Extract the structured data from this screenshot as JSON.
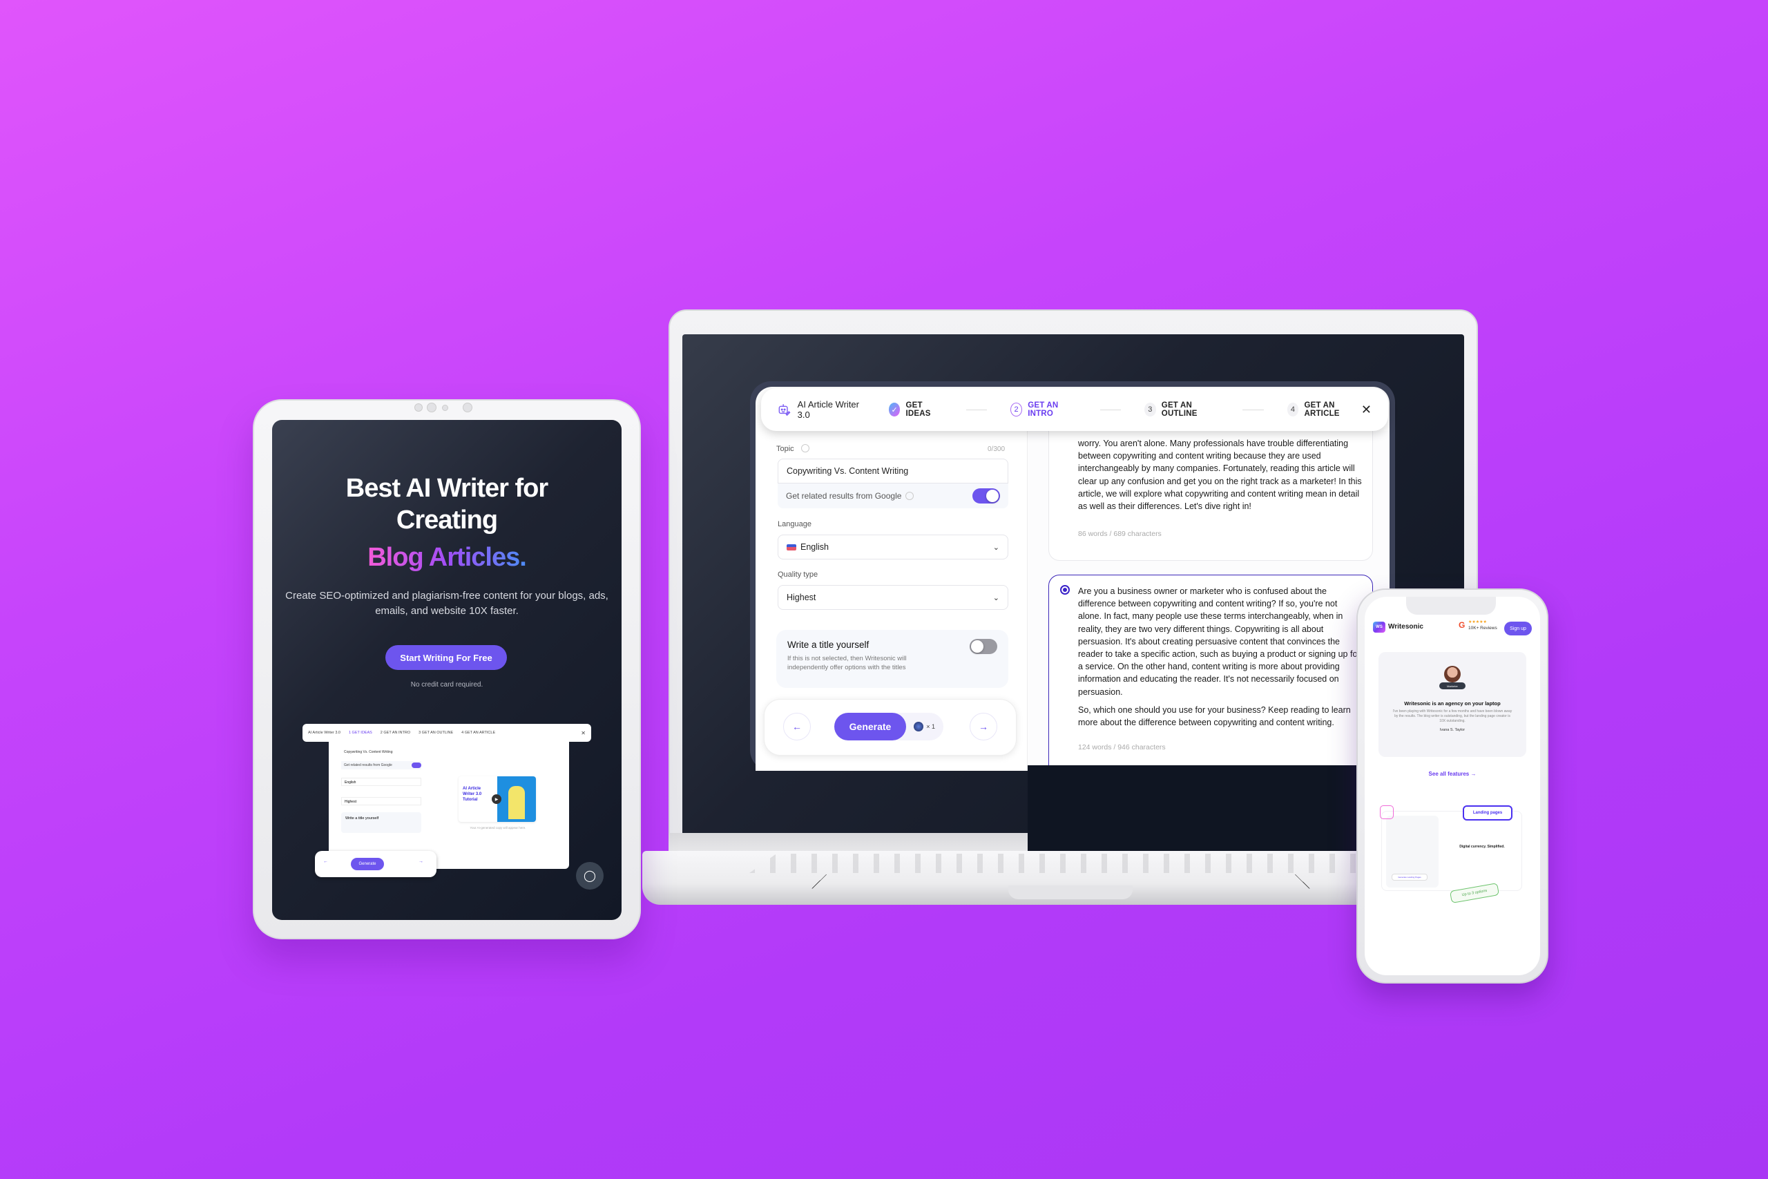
{
  "laptop": {
    "app": {
      "title": "AI Article Writer 3.0",
      "steps": [
        {
          "num": "✓",
          "label": "GET IDEAS",
          "state": "done"
        },
        {
          "num": "2",
          "label": "GET AN INTRO",
          "state": "active"
        },
        {
          "num": "3",
          "label": "GET AN OUTLINE",
          "state": "pending"
        },
        {
          "num": "4",
          "label": "GET AN ARTICLE",
          "state": "pending"
        }
      ],
      "close": "✕",
      "form": {
        "topic_label": "Topic",
        "topic_count": "0/300",
        "topic_value": "Copywriting Vs. Content Writing",
        "google_label": "Get related results from Google",
        "google_toggle": true,
        "language_label": "Language",
        "language_value": "English",
        "quality_label": "Quality type",
        "quality_value": "Highest",
        "title_heading": "Write a title yourself",
        "title_desc": "If this is not selected, then Writesonic will independently offer options with the titles",
        "title_toggle": false,
        "back_icon": "←",
        "generate_label": "Generate",
        "credits": "× 1",
        "next_icon": "→"
      },
      "results": [
        {
          "text": "worry. You aren't alone. Many professionals have trouble differentiating between copywriting and content writing because they are used interchangeably by many companies. Fortunately, reading this article will clear up any confusion and get you on the right track as a marketer! In this article, we will explore what copywriting and content writing mean in detail as well as their differences. Let's dive right in!",
          "meta": "86 words / 689 characters",
          "selected": false
        },
        {
          "text": "Are you a business owner or marketer who is confused about the difference between copywriting and content writing? If so, you're not alone. In fact, many people use these terms interchangeably, when in reality, they are two very different things. Copywriting is all about persuasion. It's about creating persuasive content that convinces the reader to take a specific action, such as buying a product or signing up for a service. On the other hand, content writing is more about providing information and educating the reader. It's not necessarily focused on persuasion.",
          "text2": "So, which one should you use for your business? Keep reading to learn more about the difference between copywriting and content writing.",
          "meta": "124 words / 946 characters",
          "selected": true
        }
      ]
    }
  },
  "tablet": {
    "headline_1": "Best AI Writer for",
    "headline_2": "Creating",
    "headline_3": "Blog Articles.",
    "subtitle": "Create SEO-optimized and plagiarism-free content for your blogs, ads, emails, and website 10X faster.",
    "cta": "Start Writing For Free",
    "note": "No credit card required.",
    "mini": {
      "title": "AI Article Writer 3.0",
      "steps": [
        "1  GET IDEAS",
        "2  GET AN INTRO",
        "3  GET AN OUTLINE",
        "4  GET AN ARTICLE"
      ],
      "topic_value": "Copywriting Vs. Content Writing",
      "google_label": "Get related results from Google",
      "language_value": "English",
      "quality_value": "Highest",
      "title_heading": "Write a title yourself",
      "video_title": "AI Article Writer 3.0 Tutorial",
      "placeholder": "Your AI-generated copy will appear here.",
      "generate_label": "Generate"
    }
  },
  "phone": {
    "brand": "Writesonic",
    "brand_badge": "WS",
    "rating_stars": "★★★★★",
    "reviews": "10K+ Reviews",
    "signup": "Sign up",
    "badge": "Marketer",
    "testimonial_title": "Writesonic is an agency on your laptop",
    "testimonial_body": "I've been playing with Writesonic for a few months and have been blown away by the results. The blog writer is outstanding, but the landing page creator is 10X outstanding.",
    "author": "Ivana S. Taylor",
    "see_all": "See all features →",
    "feature_tag": "Landing pages",
    "demo_heading": "Digital currency. Simplified.",
    "demo_button": "Generate Landing Pages",
    "options_tag": "Up to 3 options"
  },
  "colors": {
    "accent": "#6d55ee",
    "background": "#c644fb",
    "selected_border": "#3b26b8"
  }
}
